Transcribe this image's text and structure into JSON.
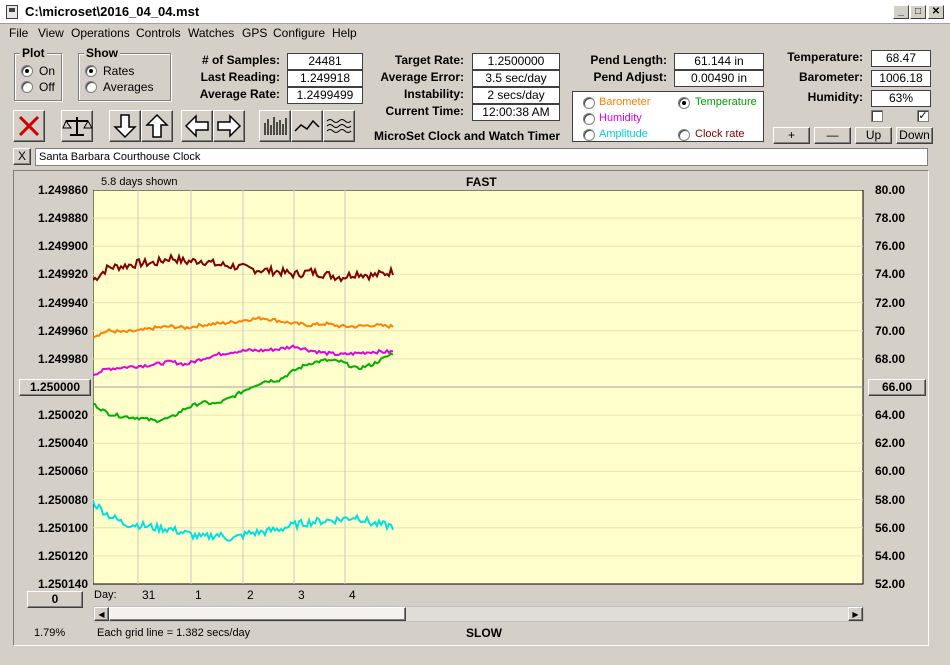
{
  "window": {
    "title": "C:\\microset\\2016_04_04.mst"
  },
  "menu": [
    "File",
    "View",
    "Operations",
    "Controls",
    "Watches",
    "GPS",
    "Configure",
    "Help"
  ],
  "plot_group": {
    "title": "Plot",
    "on_label": "On",
    "off_label": "Off",
    "selected": "On"
  },
  "show_group": {
    "title": "Show",
    "rates_label": "Rates",
    "averages_label": "Averages",
    "selected": "Rates"
  },
  "stats": {
    "samples_label": "# of Samples:",
    "samples": "24481",
    "last_reading_label": "Last Reading:",
    "last_reading": "1.249918",
    "average_rate_label": "Average Rate:",
    "average_rate": "1.2499499",
    "target_rate_label": "Target Rate:",
    "target_rate": "1.2500000",
    "average_error_label": "Average Error:",
    "average_error": "3.5 sec/day",
    "instability_label": "Instability:",
    "instability": "2 secs/day",
    "current_time_label": "Current Time:",
    "current_time": "12:00:38 AM",
    "pend_length_label": "Pend Length:",
    "pend_length": "61.144 in",
    "pend_adjust_label": "Pend Adjust:",
    "pend_adjust": "0.00490 in",
    "temperature_label": "Temperature:",
    "temperature": "68.47",
    "barometer_label": "Barometer:",
    "barometer": "1006.18",
    "humidity_label": "Humidity:",
    "humidity": "63%"
  },
  "app_name": "MicroSet Clock and Watch Timer",
  "series_selector": {
    "barometer": "Barometer",
    "temperature": "Temperature",
    "humidity": "Humidity",
    "amplitude": "Amplitude",
    "clock_rate": "Clock rate",
    "selected": "Temperature"
  },
  "adjust_buttons": {
    "plus": "+",
    "minus": "—",
    "up": "Up",
    "down": "Down"
  },
  "checkboxes": {
    "left_checked": false,
    "right_checked": true
  },
  "clock_name": "Santa Barbara Courthouse Clock",
  "close_x": "X",
  "chart_header": {
    "days_shown": "5.8 days shown",
    "fast": "FAST",
    "slow": "SLOW"
  },
  "chart_footer": {
    "percent": "1.79%",
    "grid_note": "Each grid line = 1.382 secs/day",
    "day_label": "Day:",
    "left_button": "0"
  },
  "center_left_button": "1.250000",
  "center_right_button": "66.00",
  "colors": {
    "plot_bg": "#ffffcc",
    "barometer": "#ff8000",
    "temperature": "#00b000",
    "humidity": "#e000e0",
    "amplitude": "#00e0e0",
    "clock_rate": "#800000"
  },
  "chart_data": {
    "type": "line",
    "title": "",
    "x_ticks": [
      "31",
      "1",
      "2",
      "3",
      "4"
    ],
    "y_left_ticks": [
      "1.249860",
      "1.249880",
      "1.249900",
      "1.249920",
      "1.249940",
      "1.249960",
      "1.249980",
      "1.250000",
      "1.250020",
      "1.250040",
      "1.250060",
      "1.250080",
      "1.250100",
      "1.250120",
      "1.250140"
    ],
    "y_right_ticks": [
      "80.00",
      "78.00",
      "76.00",
      "74.00",
      "72.00",
      "70.00",
      "68.00",
      "66.00",
      "64.00",
      "62.00",
      "60.00",
      "58.00",
      "56.00",
      "54.00",
      "52.00"
    ],
    "ylim_right": [
      52,
      80
    ],
    "x_range_days": [
      0,
      5.8
    ],
    "x": [
      0,
      0.3,
      0.6,
      0.9,
      1.2,
      1.5,
      1.8,
      2.1,
      2.4,
      2.7,
      3.0,
      3.3,
      3.6,
      3.9,
      4.2,
      4.5,
      4.8,
      5.1,
      5.4,
      5.8
    ],
    "series": [
      {
        "key": "clock_rate",
        "color": "#800000",
        "noise": 0.3,
        "values": [
          73.6,
          74.5,
          74.6,
          74.8,
          74.8,
          75.2,
          74.9,
          75.0,
          74.7,
          74.6,
          74.4,
          74.3,
          74.2,
          74.0,
          74.2,
          74.0,
          73.8,
          74.1,
          73.9,
          74.2
        ]
      },
      {
        "key": "barometer",
        "color": "#ff8000",
        "noise": 0.12,
        "values": [
          69.6,
          70.0,
          69.9,
          70.0,
          70.2,
          70.3,
          70.2,
          70.4,
          70.5,
          70.6,
          70.8,
          70.9,
          70.7,
          70.5,
          70.4,
          70.5,
          70.3,
          70.3,
          70.4,
          70.3
        ]
      },
      {
        "key": "humidity",
        "color": "#e000e0",
        "noise": 0.12,
        "values": [
          66.9,
          67.3,
          67.4,
          67.5,
          67.6,
          67.8,
          67.6,
          68.0,
          68.3,
          68.5,
          68.6,
          68.6,
          68.7,
          68.9,
          68.6,
          68.4,
          68.3,
          68.4,
          68.5,
          68.5
        ]
      },
      {
        "key": "temperature",
        "color": "#00b000",
        "noise": 0.12,
        "values": [
          64.8,
          64.1,
          63.9,
          63.8,
          63.6,
          63.8,
          64.5,
          64.9,
          64.8,
          65.3,
          65.9,
          66.4,
          66.5,
          67.2,
          67.7,
          67.9,
          67.8,
          67.3,
          67.6,
          68.4
        ]
      },
      {
        "key": "amplitude",
        "color": "#00e0e0",
        "noise": 0.28,
        "values": [
          57.8,
          56.9,
          56.3,
          56.2,
          56.0,
          55.9,
          55.6,
          55.3,
          55.5,
          55.2,
          55.6,
          55.7,
          55.9,
          56.2,
          56.4,
          56.5,
          56.6,
          56.8,
          56.3,
          56.1
        ]
      }
    ]
  }
}
